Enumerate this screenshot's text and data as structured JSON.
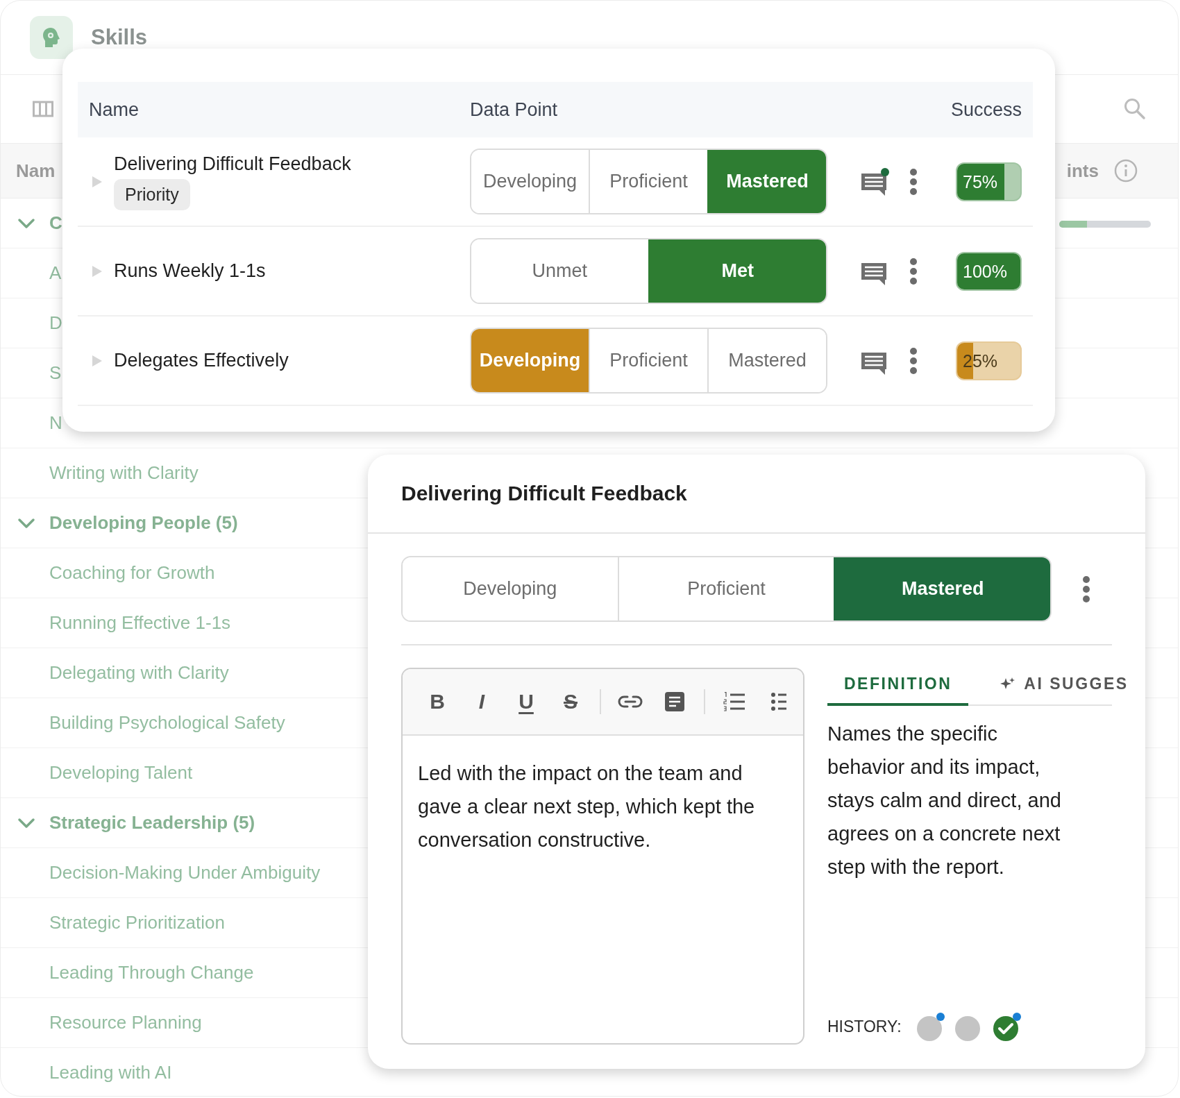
{
  "page": {
    "title": "Skills"
  },
  "table": {
    "columns": [
      "Nam",
      "ints"
    ],
    "groups": [
      {
        "name": "C",
        "expanded": true,
        "level": 0.3,
        "children": [
          {
            "name": "A"
          },
          {
            "name": "D"
          },
          {
            "name": "S"
          },
          {
            "name": "N"
          },
          {
            "name": "Writing with Clarity"
          }
        ]
      },
      {
        "name": "Developing People (5)",
        "expanded": true,
        "children": [
          {
            "name": "Coaching for Growth"
          },
          {
            "name": "Running Effective 1-1s"
          },
          {
            "name": "Delegating with Clarity"
          },
          {
            "name": "Building Psychological Safety"
          },
          {
            "name": "Developing Talent"
          }
        ]
      },
      {
        "name": "Strategic Leadership (5)",
        "expanded": true,
        "children": [
          {
            "name": "Decision-Making Under Ambiguity"
          },
          {
            "name": "Strategic Prioritization"
          },
          {
            "name": "Leading Through Change"
          },
          {
            "name": "Resource Planning"
          },
          {
            "name": "Leading with AI"
          }
        ]
      }
    ]
  },
  "data_points_popover": {
    "columns": [
      "Name",
      "Data Point",
      "Success"
    ],
    "rows": [
      {
        "name": "Delivering Difficult Feedback",
        "tag": "Priority",
        "color": "#2e7d32",
        "options": [
          {
            "label": "Developing",
            "selected": false
          },
          {
            "label": "Proficient",
            "selected": false
          },
          {
            "label": "Mastered",
            "selected": true
          }
        ],
        "unread_comment": true,
        "success": "75%",
        "level": 0.75
      },
      {
        "name": "Runs Weekly 1-1s",
        "color": "#2e7d32",
        "options": [
          {
            "label": "Unmet",
            "selected": false
          },
          {
            "label": "Met",
            "selected": true
          }
        ],
        "unread_comment": false,
        "success": "100%",
        "level": 1
      },
      {
        "name": "Delegates Effectively",
        "color": "#c88a1c",
        "options": [
          {
            "label": "Developing",
            "selected": true
          },
          {
            "label": "Proficient",
            "selected": false
          },
          {
            "label": "Mastered",
            "selected": false
          }
        ],
        "unread_comment": false,
        "success": "25%",
        "level": 0.25
      }
    ]
  },
  "detail": {
    "title": "Delivering Difficult Feedback",
    "options": [
      {
        "label": "Developing",
        "selected": false
      },
      {
        "label": "Proficient",
        "selected": false
      },
      {
        "label": "Mastered",
        "selected": true
      }
    ],
    "editor": {
      "toolbar": [
        [
          {
            "kind": "bold",
            "label": "B"
          },
          {
            "kind": "italic",
            "label": "I"
          },
          {
            "kind": "underline",
            "label": "U"
          },
          {
            "kind": "strike",
            "label": "S"
          }
        ],
        [
          {
            "kind": "link"
          },
          {
            "kind": "note"
          }
        ],
        [
          {
            "kind": "numbered-list"
          },
          {
            "kind": "bullet-list"
          }
        ]
      ],
      "value": "Led with the impact on the team and gave a clear next step, which kept the conversation constructive."
    },
    "tabs": [
      {
        "label": "DEFINITION",
        "kind": "plain",
        "selected": true
      },
      {
        "label": "AI SUGGES",
        "kind": "ai",
        "selected": false
      }
    ],
    "definition": "Names the specific behavior and its impact, stays calm and direct, and agrees on a concrete next step with the report.",
    "history": {
      "label": "HISTORY:",
      "items": [
        {
          "kind": "empty",
          "flagged": true
        },
        {
          "kind": "empty",
          "flagged": false
        },
        {
          "kind": "check",
          "flagged": true
        }
      ]
    }
  }
}
